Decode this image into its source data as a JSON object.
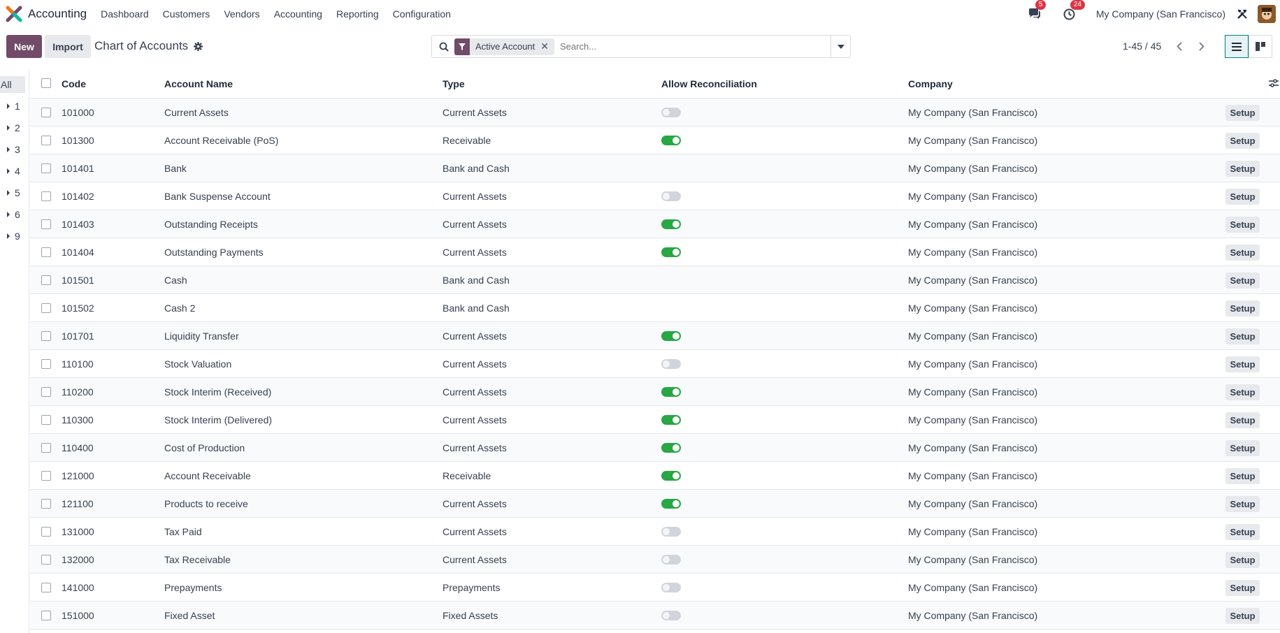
{
  "navbar": {
    "app_name": "Accounting",
    "menu": [
      "Dashboard",
      "Customers",
      "Vendors",
      "Accounting",
      "Reporting",
      "Configuration"
    ],
    "messages_count": "5",
    "activities_count": "24",
    "company": "My Company (San Francisco)"
  },
  "control": {
    "new_label": "New",
    "import_label": "Import",
    "breadcrumb": "Chart of Accounts",
    "facet_label": "Active Account",
    "search_placeholder": "Search...",
    "pager": "1-45 / 45"
  },
  "sidebar": {
    "all_label": "All",
    "groups": [
      "1",
      "2",
      "3",
      "4",
      "5",
      "6",
      "9"
    ]
  },
  "table": {
    "columns": {
      "code": "Code",
      "name": "Account Name",
      "type": "Type",
      "reconcile": "Allow Reconciliation",
      "company": "Company"
    },
    "setup_label": "Setup",
    "rows": [
      {
        "code": "101000",
        "name": "Current Assets",
        "type": "Current Assets",
        "reconcile": "off",
        "company": "My Company (San Francisco)"
      },
      {
        "code": "101300",
        "name": "Account Receivable (PoS)",
        "type": "Receivable",
        "reconcile": "on",
        "company": "My Company (San Francisco)"
      },
      {
        "code": "101401",
        "name": "Bank",
        "type": "Bank and Cash",
        "reconcile": "none",
        "company": "My Company (San Francisco)"
      },
      {
        "code": "101402",
        "name": "Bank Suspense Account",
        "type": "Current Assets",
        "reconcile": "off",
        "company": "My Company (San Francisco)"
      },
      {
        "code": "101403",
        "name": "Outstanding Receipts",
        "type": "Current Assets",
        "reconcile": "on",
        "company": "My Company (San Francisco)"
      },
      {
        "code": "101404",
        "name": "Outstanding Payments",
        "type": "Current Assets",
        "reconcile": "on",
        "company": "My Company (San Francisco)"
      },
      {
        "code": "101501",
        "name": "Cash",
        "type": "Bank and Cash",
        "reconcile": "none",
        "company": "My Company (San Francisco)"
      },
      {
        "code": "101502",
        "name": "Cash 2",
        "type": "Bank and Cash",
        "reconcile": "none",
        "company": "My Company (San Francisco)"
      },
      {
        "code": "101701",
        "name": "Liquidity Transfer",
        "type": "Current Assets",
        "reconcile": "on",
        "company": "My Company (San Francisco)"
      },
      {
        "code": "110100",
        "name": "Stock Valuation",
        "type": "Current Assets",
        "reconcile": "off",
        "company": "My Company (San Francisco)"
      },
      {
        "code": "110200",
        "name": "Stock Interim (Received)",
        "type": "Current Assets",
        "reconcile": "on",
        "company": "My Company (San Francisco)"
      },
      {
        "code": "110300",
        "name": "Stock Interim (Delivered)",
        "type": "Current Assets",
        "reconcile": "on",
        "company": "My Company (San Francisco)"
      },
      {
        "code": "110400",
        "name": "Cost of Production",
        "type": "Current Assets",
        "reconcile": "on",
        "company": "My Company (San Francisco)"
      },
      {
        "code": "121000",
        "name": "Account Receivable",
        "type": "Receivable",
        "reconcile": "on",
        "company": "My Company (San Francisco)"
      },
      {
        "code": "121100",
        "name": "Products to receive",
        "type": "Current Assets",
        "reconcile": "on",
        "company": "My Company (San Francisco)"
      },
      {
        "code": "131000",
        "name": "Tax Paid",
        "type": "Current Assets",
        "reconcile": "off",
        "company": "My Company (San Francisco)"
      },
      {
        "code": "132000",
        "name": "Tax Receivable",
        "type": "Current Assets",
        "reconcile": "off",
        "company": "My Company (San Francisco)"
      },
      {
        "code": "141000",
        "name": "Prepayments",
        "type": "Prepayments",
        "reconcile": "off",
        "company": "My Company (San Francisco)"
      },
      {
        "code": "151000",
        "name": "Fixed Asset",
        "type": "Fixed Assets",
        "reconcile": "off",
        "company": "My Company (San Francisco)"
      }
    ]
  },
  "colors": {
    "brand": "#714b67",
    "toggle_on": "#28a745",
    "badge": "#dc3545",
    "active_view": "#017e84"
  }
}
